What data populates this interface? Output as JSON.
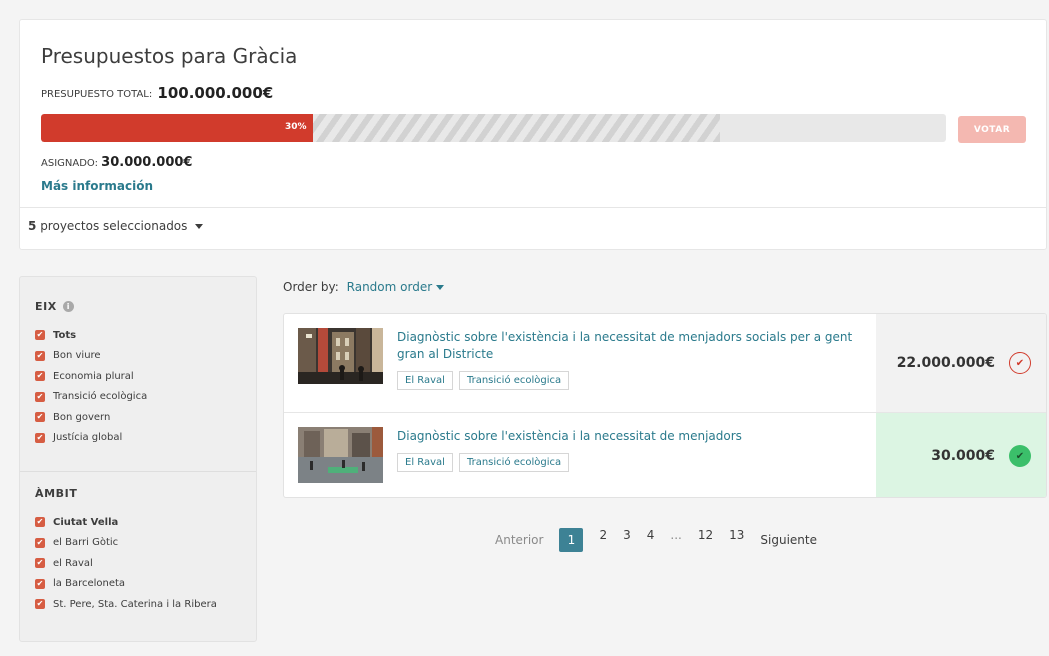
{
  "budget": {
    "title": "Presupuestos para Gràcia",
    "total_label": "PRESUPUESTO TOTAL:",
    "total_value": "100.000.000€",
    "progress_percent": 30,
    "progress_label": "30%",
    "hatch_percent": 75,
    "vote_label": "VOTAR",
    "assigned_label": "ASIGNADO:",
    "assigned_value": "30.000.000€",
    "more_info": "Más información",
    "selected_count": "5",
    "selected_text": "proyectos seleccionados",
    "colors": {
      "fill": "#d13b2c",
      "vote_disabled": "#f4b8b1",
      "link": "#2a7a8c"
    }
  },
  "filters": {
    "eix": {
      "heading": "EIX",
      "items": [
        "Tots",
        "Bon viure",
        "Economia plural",
        "Transició ecològica",
        "Bon govern",
        "Justícia global"
      ]
    },
    "ambit": {
      "heading": "ÀMBIT",
      "items": [
        "Ciutat Vella",
        "el Barri Gòtic",
        "el Raval",
        "la Barceloneta",
        "St. Pere, Sta. Caterina i la Ribera"
      ]
    }
  },
  "order": {
    "label": "Order by:",
    "value": "Random order"
  },
  "projects": [
    {
      "title": "Diagnòstic sobre l'existència i la necessitat de menjadors socials per a gent gran al Districte",
      "tags": [
        "El Raval",
        "Transició ecològica"
      ],
      "price": "22.000.000€",
      "selected": false,
      "thumb_icon": "street-photo"
    },
    {
      "title": "Diagnòstic sobre l'existència i la necessitat de menjadors",
      "tags": [
        "El Raval",
        "Transició ecològica"
      ],
      "price": "30.000€",
      "selected": true,
      "thumb_icon": "square-photo"
    }
  ],
  "pagination": {
    "prev": "Anterior",
    "pages": [
      "1",
      "2",
      "3",
      "4",
      "...",
      "12",
      "13"
    ],
    "current": "1",
    "next": "Siguiente"
  }
}
